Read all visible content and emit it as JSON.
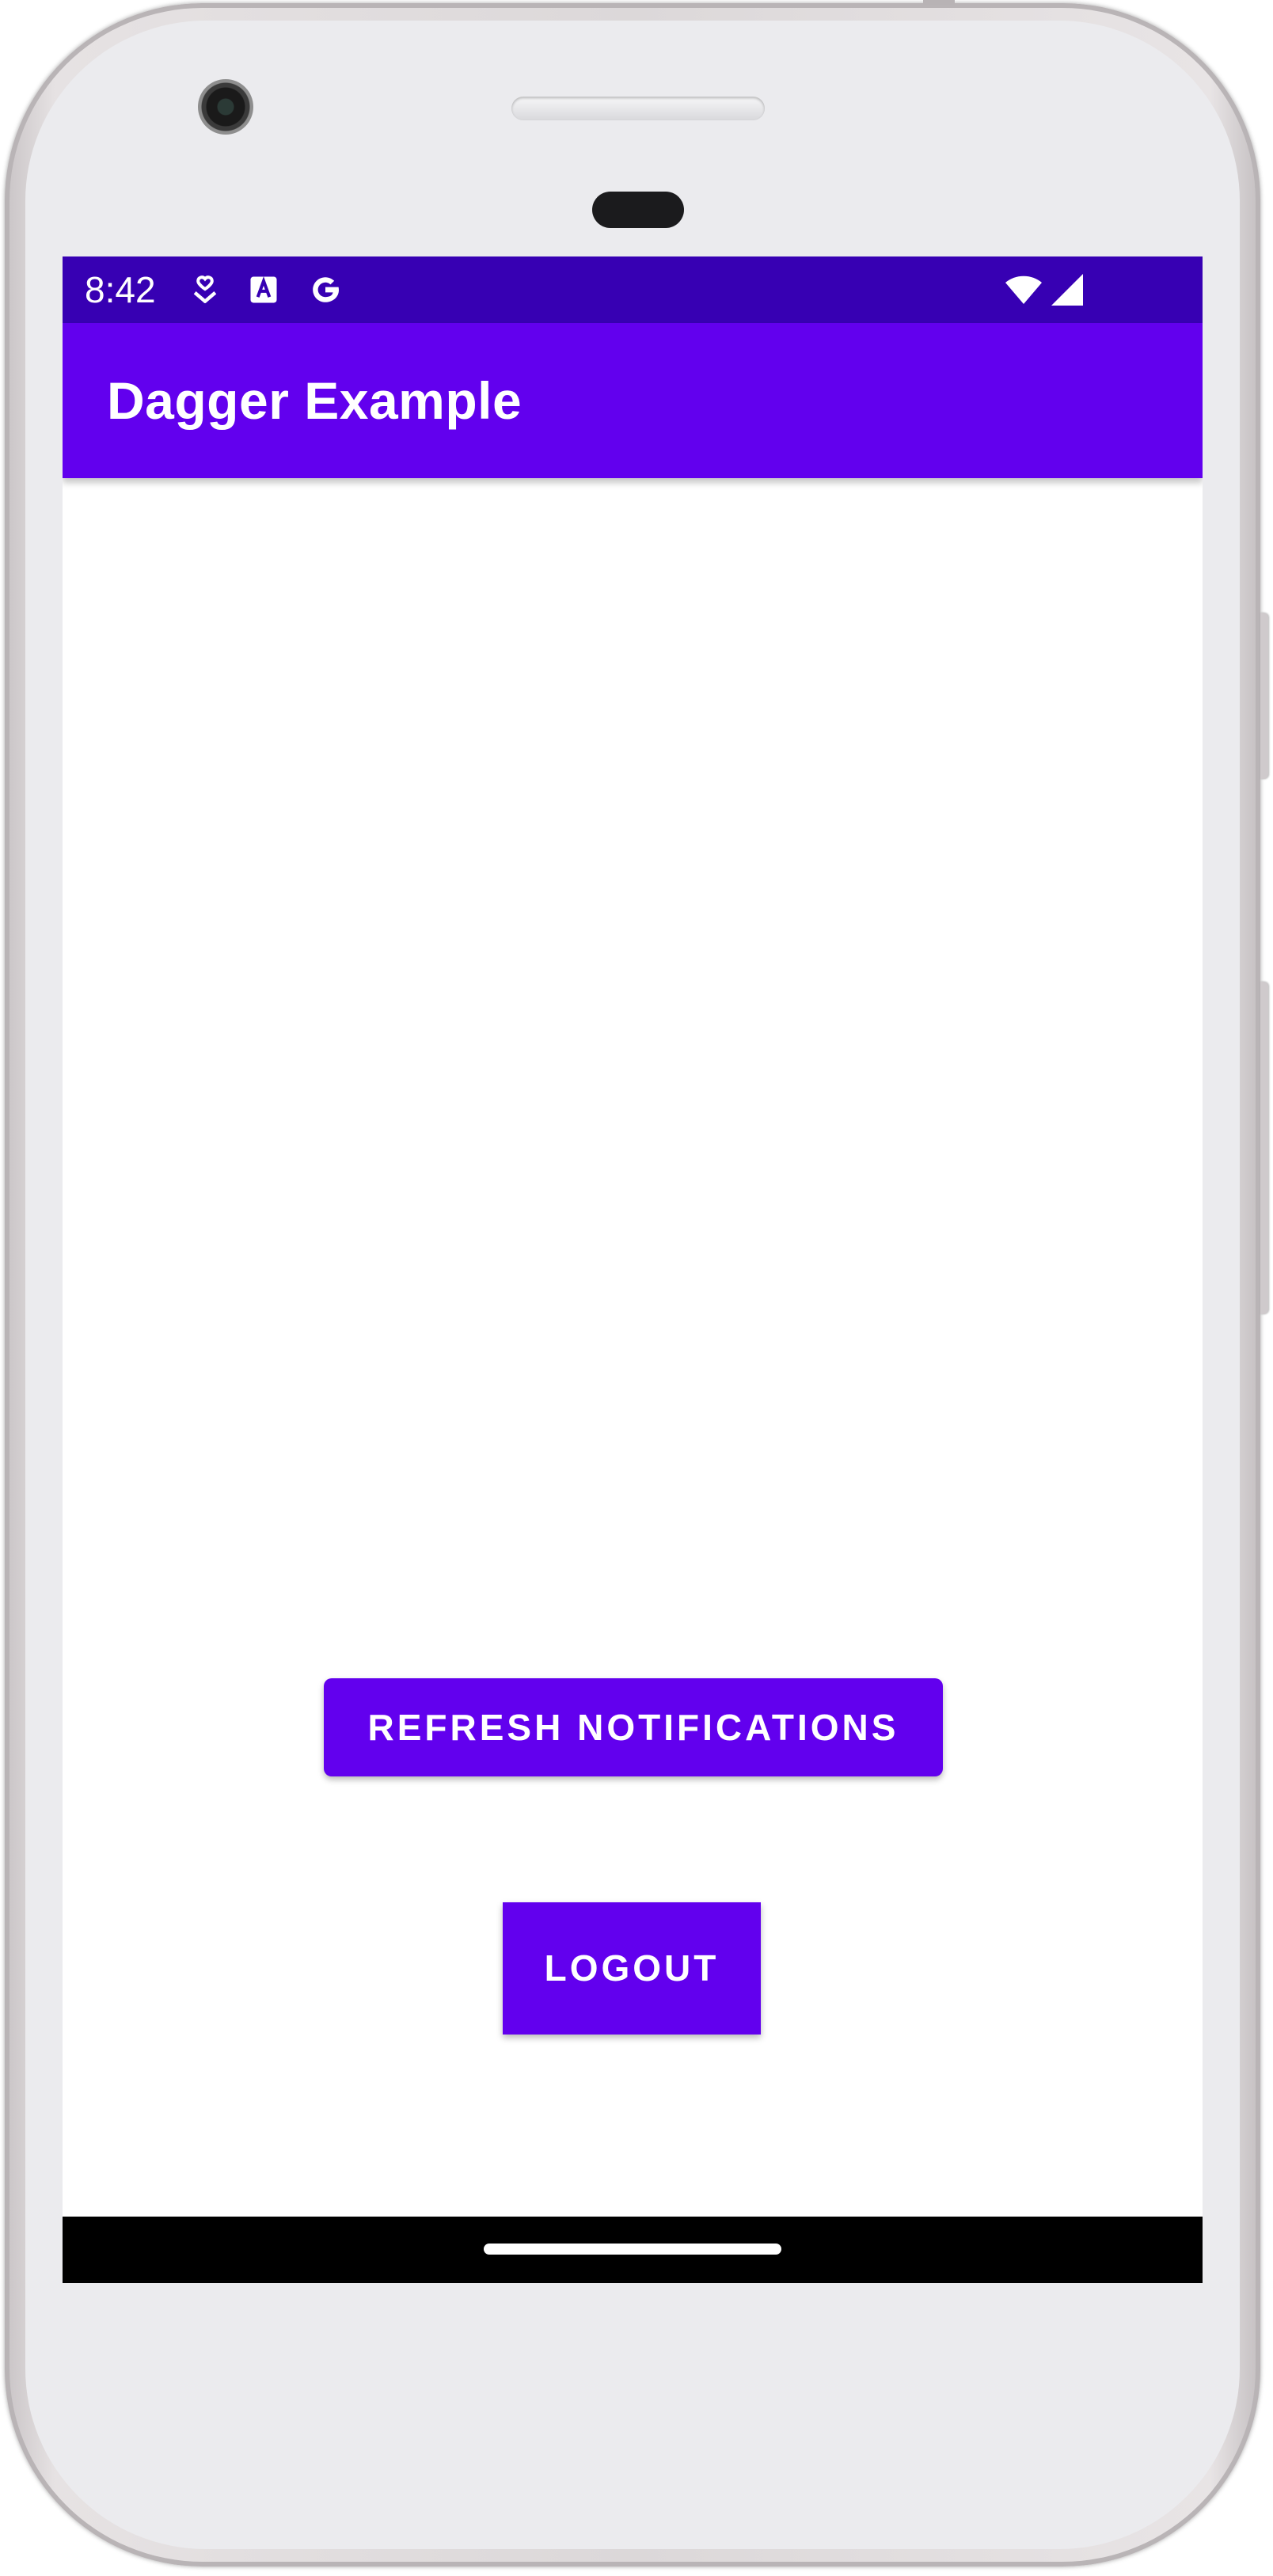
{
  "status_bar": {
    "time": "8:42",
    "left_icons": [
      "heart-hand-icon",
      "font-a-icon",
      "google-g-icon"
    ],
    "right_icons": [
      "wifi-icon",
      "cell-signal-icon"
    ],
    "background": "#3700b3"
  },
  "app_bar": {
    "title": "Dagger Example",
    "background": "#6200ee"
  },
  "main": {
    "refresh_button_label": "REFRESH NOTIFICATIONS",
    "logout_button_label": "LOGOUT",
    "button_color": "#6200ee"
  },
  "navigation": {
    "home_handle": "gesture-handle"
  }
}
